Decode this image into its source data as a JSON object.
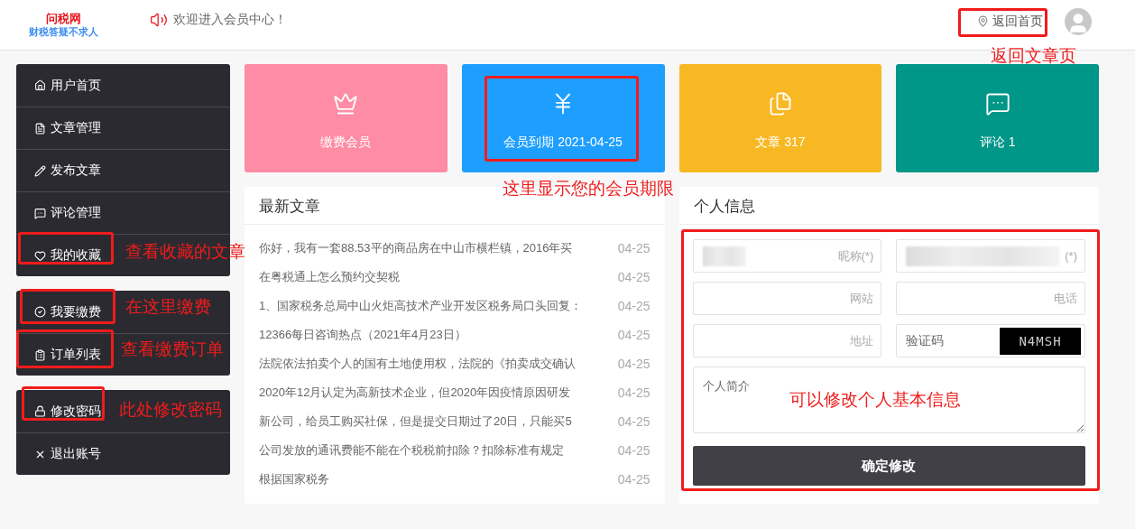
{
  "header": {
    "logo_title": "问税网",
    "logo_slogan": "财税答疑不求人",
    "notice": "欢迎进入会员中心！",
    "home_link": "返回首页"
  },
  "sidebar": {
    "groups": [
      {
        "items": [
          {
            "label": "用户首页"
          },
          {
            "label": "文章管理"
          },
          {
            "label": "发布文章"
          },
          {
            "label": "评论管理"
          },
          {
            "label": "我的收藏"
          }
        ]
      },
      {
        "items": [
          {
            "label": "我要缴费"
          },
          {
            "label": "订单列表"
          }
        ]
      },
      {
        "items": [
          {
            "label": "修改密码"
          },
          {
            "label": "退出账号"
          }
        ]
      }
    ]
  },
  "stat_cards": [
    {
      "label": "缴费会员",
      "color": "#fe8ca4"
    },
    {
      "label": "会员到期 2021-04-25",
      "color": "#1e9fff"
    },
    {
      "label": "文章 317",
      "color": "#f8b824"
    },
    {
      "label": "评论 1",
      "color": "#009688"
    }
  ],
  "latest_articles": {
    "title": "最新文章",
    "rows": [
      {
        "title": "你好，我有一套88.53平的商品房在中山市横栏镇，2016年买",
        "date": "04-25"
      },
      {
        "title": "在粤税通上怎么预约交契税",
        "date": "04-25"
      },
      {
        "title": "1、国家税务总局中山火炬高技术产业开发区税务局口头回复：",
        "date": "04-25"
      },
      {
        "title": "12366每日咨询热点（2021年4月23日）",
        "date": "04-25"
      },
      {
        "title": "法院依法拍卖个人的国有土地使用权，法院的《拍卖成交确认",
        "date": "04-25"
      },
      {
        "title": "2020年12月认定为高新技术企业，但2020年因疫情原因研发",
        "date": "04-25"
      },
      {
        "title": "新公司，给员工购买社保，但是提交日期过了20日，只能买5",
        "date": "04-25"
      },
      {
        "title": "公司发放的通讯费能不能在个税税前扣除？扣除标准有规定",
        "date": "04-25"
      },
      {
        "title": "根据国家税务",
        "date": "04-25"
      }
    ]
  },
  "profile": {
    "title": "个人信息",
    "fields": [
      {
        "kind": "input",
        "placeholder": "昵称(*)",
        "blurred": true
      },
      {
        "kind": "input",
        "placeholder": "(*)",
        "blurred": true
      },
      {
        "kind": "input",
        "placeholder": "网站",
        "blurred": false
      },
      {
        "kind": "input",
        "placeholder": "电话",
        "blurred": false
      },
      {
        "kind": "input",
        "placeholder": "地址",
        "blurred": false
      },
      {
        "kind": "captcha",
        "placeholder": "验证码",
        "captcha": "N4MSH"
      }
    ],
    "bio_placeholder": "个人简介",
    "submit": "确定修改"
  },
  "annotations": [
    {
      "text": "返回文章页"
    },
    {
      "text": "这里显示您的会员期限"
    },
    {
      "text": "查看收藏的文章"
    },
    {
      "text": "在这里缴费"
    },
    {
      "text": "查看缴费订单"
    },
    {
      "text": "此处修改密码"
    },
    {
      "text": "可以修改个人基本信息"
    }
  ]
}
